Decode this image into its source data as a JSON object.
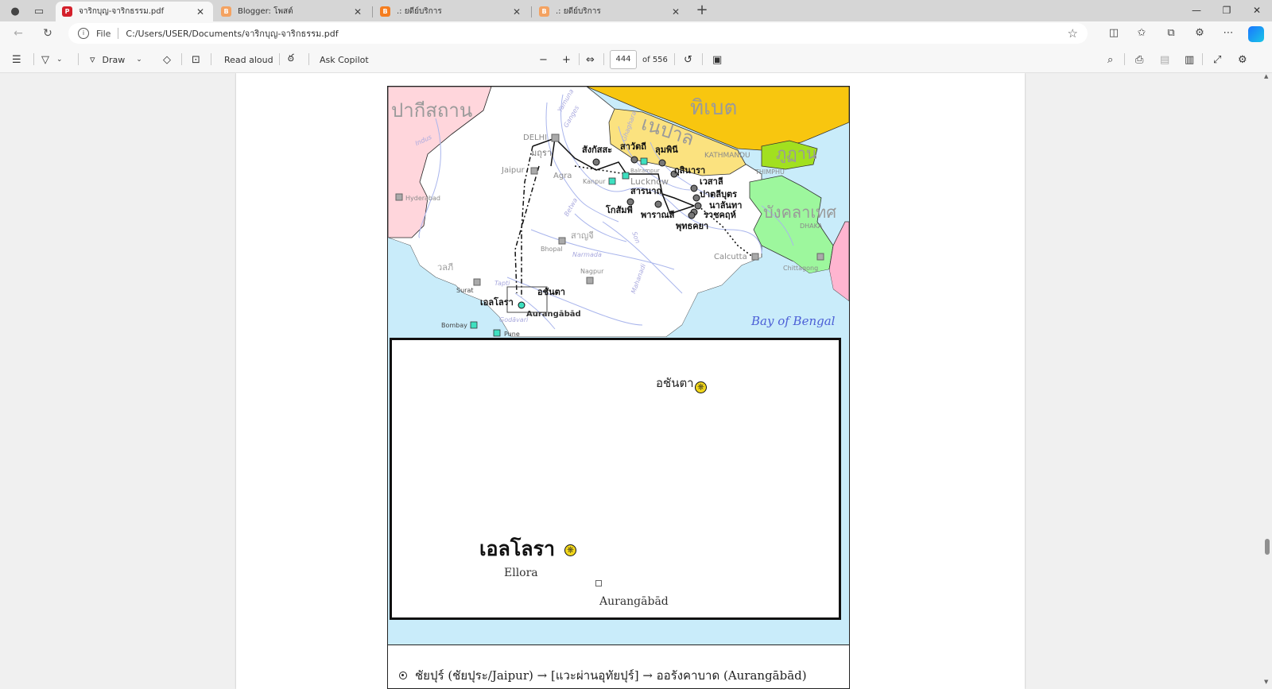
{
  "tabs": [
    {
      "title": "จาริกบุญ-จาริกธรรม.pdf",
      "icon": "pdf-icon",
      "active": true
    },
    {
      "title": "Blogger: โพสต์",
      "icon": "blogger-icon",
      "active": false
    },
    {
      "title": ".: ยดีย์บริการ",
      "icon": "blogger-icon",
      "active": false
    },
    {
      "title": ".: ยดีย์บริการ",
      "icon": "blogger-icon",
      "active": false
    }
  ],
  "address": {
    "scheme": "File",
    "url": "C:/Users/USER/Documents/จาริกบุญ-จาริกธรรม.pdf"
  },
  "pdf_toolbar": {
    "draw": "Draw",
    "read_aloud": "Read aloud",
    "ask_copilot": "Ask Copilot",
    "page_current": "444",
    "page_total": "of 556"
  },
  "map": {
    "regions": {
      "pakistan": "ปากีสถาน",
      "tibet": "ทิเบต",
      "nepal": "เนปาล",
      "bhutan": "ภูฏาน",
      "bangladesh": "บังคลาเทศ",
      "bay": "Bay of Bengal"
    },
    "cities": [
      {
        "label": "DELHI"
      },
      {
        "label": "Jaipur"
      },
      {
        "label": "Agra"
      },
      {
        "label": "Kanpur"
      },
      {
        "label": "Lucknow"
      },
      {
        "label": "Hyderabad"
      },
      {
        "label": "Bhopal"
      },
      {
        "label": "Nagpur"
      },
      {
        "label": "Surat"
      },
      {
        "label": "Bombay"
      },
      {
        "label": "Pune"
      },
      {
        "label": "Aurangābād"
      },
      {
        "label": "Calcutta"
      },
      {
        "label": "KATHMANDU"
      },
      {
        "label": "THIMPHU"
      },
      {
        "label": "DHAKA"
      },
      {
        "label": "Chittagong"
      },
      {
        "label": "Balrampur"
      }
    ],
    "sites": [
      {
        "label": "มถุรา"
      },
      {
        "label": "สังกัสสะ"
      },
      {
        "label": "สาวัตถี"
      },
      {
        "label": "ลุมพินี"
      },
      {
        "label": "กุสินารา"
      },
      {
        "label": "เวสาลี"
      },
      {
        "label": "สารนาถ"
      },
      {
        "label": "ปาตลีบุตร"
      },
      {
        "label": "นาลันทา"
      },
      {
        "label": "โกสัมพี"
      },
      {
        "label": "พาราณสี"
      },
      {
        "label": "ราชคฤห์"
      },
      {
        "label": "พุทธคยา"
      },
      {
        "label": "สาญจี"
      },
      {
        "label": "วลภี"
      },
      {
        "label": "อชันตา"
      },
      {
        "label": "เอลโลรา"
      }
    ],
    "rivers": [
      "Yamuna",
      "Ganges",
      "Indus",
      "Betwa",
      "Narmada",
      "Tapti",
      "Godāvari",
      "Mahanadi",
      "Son",
      "Ghaghara"
    ]
  },
  "inset": {
    "ajanta": "อชันตา",
    "ellora_thai": "เอลโลรา",
    "ellora_en": "Ellora",
    "aurangabad": "Aurangābād"
  },
  "caption": {
    "text": "ชัยปุร์ (ชัยปุระ/Jaipur) → [แวะผ่านอุทัยปุร์] → ออรังคาบาด (Aurangābād)"
  }
}
